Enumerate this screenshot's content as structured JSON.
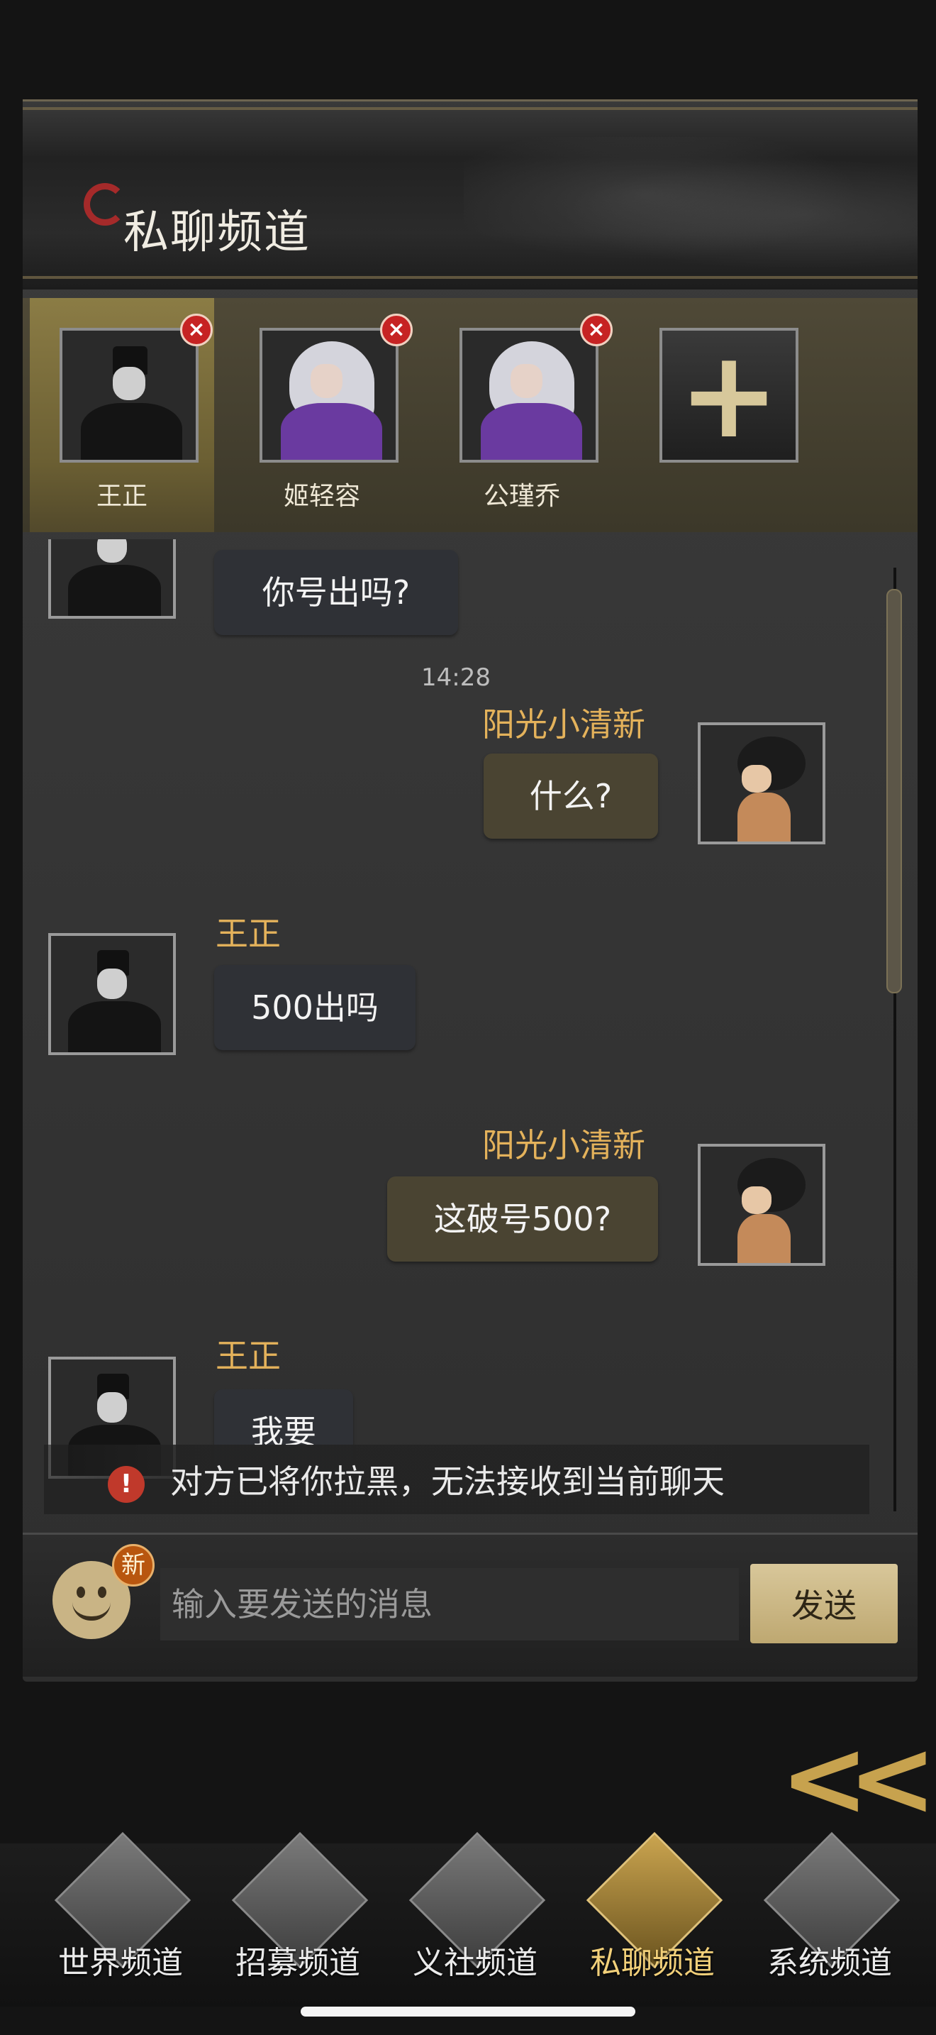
{
  "header": {
    "title": "私聊频道"
  },
  "contacts": [
    {
      "name": "王正",
      "active": true
    },
    {
      "name": "姬轻容",
      "active": false
    },
    {
      "name": "公瑾乔",
      "active": false
    }
  ],
  "add_contact_label": "+",
  "close_label": "×",
  "messages": [
    {
      "direction": "in",
      "sender": "",
      "text": "你号出吗?"
    },
    {
      "timestamp": "14:28"
    },
    {
      "direction": "out",
      "sender": "阳光小清新",
      "text": "什么?"
    },
    {
      "direction": "in",
      "sender": "王正",
      "text": "500出吗"
    },
    {
      "direction": "out",
      "sender": "阳光小清新",
      "text": "这破号500?"
    },
    {
      "direction": "in",
      "sender": "王正",
      "text": "我要"
    }
  ],
  "notice": {
    "icon": "!",
    "text": "对方已将你拉黑，无法接收到当前聊天"
  },
  "input": {
    "emoji_badge": "新",
    "placeholder": "输入要发送的消息",
    "send_label": "发送"
  },
  "back_label": "<<",
  "tabs": [
    {
      "label": "世界频道",
      "icon": "world-icon",
      "active": false
    },
    {
      "label": "招募频道",
      "icon": "recruit-icon",
      "active": false
    },
    {
      "label": "义社频道",
      "icon": "guild-icon",
      "active": false
    },
    {
      "label": "私聊频道",
      "icon": "private-chat-icon",
      "active": true
    },
    {
      "label": "系统频道",
      "icon": "system-icon",
      "active": false
    }
  ],
  "colors": {
    "accent": "#e4b25b",
    "panel": "#3b3b3b",
    "active_contact": "#8b7c45"
  }
}
